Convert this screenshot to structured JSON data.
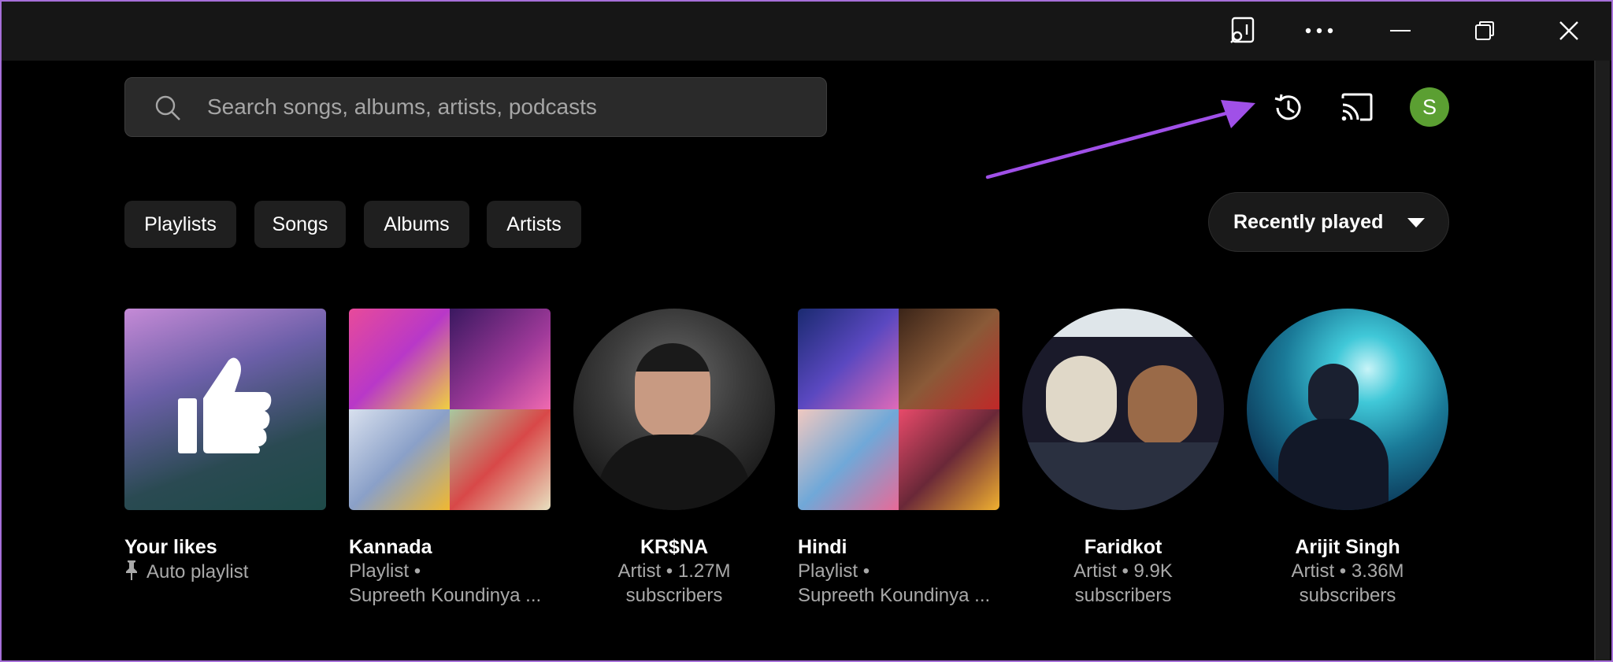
{
  "search": {
    "placeholder": "Search songs, albums, artists, podcasts"
  },
  "user": {
    "initial": "S"
  },
  "filters": [
    "Playlists",
    "Songs",
    "Albums",
    "Artists"
  ],
  "sort": {
    "label": "Recently played"
  },
  "items": [
    {
      "title": "Your likes",
      "subtitle": "Auto playlist"
    },
    {
      "title": "Kannada",
      "subtitle_line1": "Playlist •",
      "subtitle_line2": "Supreeth Koundinya ..."
    },
    {
      "title": "KR$NA",
      "subtitle_line1": "Artist • 1.27M",
      "subtitle_line2": "subscribers"
    },
    {
      "title": "Hindi",
      "subtitle_line1": "Playlist •",
      "subtitle_line2": "Supreeth Koundinya ..."
    },
    {
      "title": "Faridkot",
      "subtitle_line1": "Artist • 9.9K",
      "subtitle_line2": "subscribers"
    },
    {
      "title": "Arijit Singh",
      "subtitle_line1": "Artist • 3.36M",
      "subtitle_line2": "subscribers"
    }
  ],
  "colors": {
    "accent_arrow": "#a050e8",
    "avatar": "#5b9f32",
    "background": "#000000"
  }
}
